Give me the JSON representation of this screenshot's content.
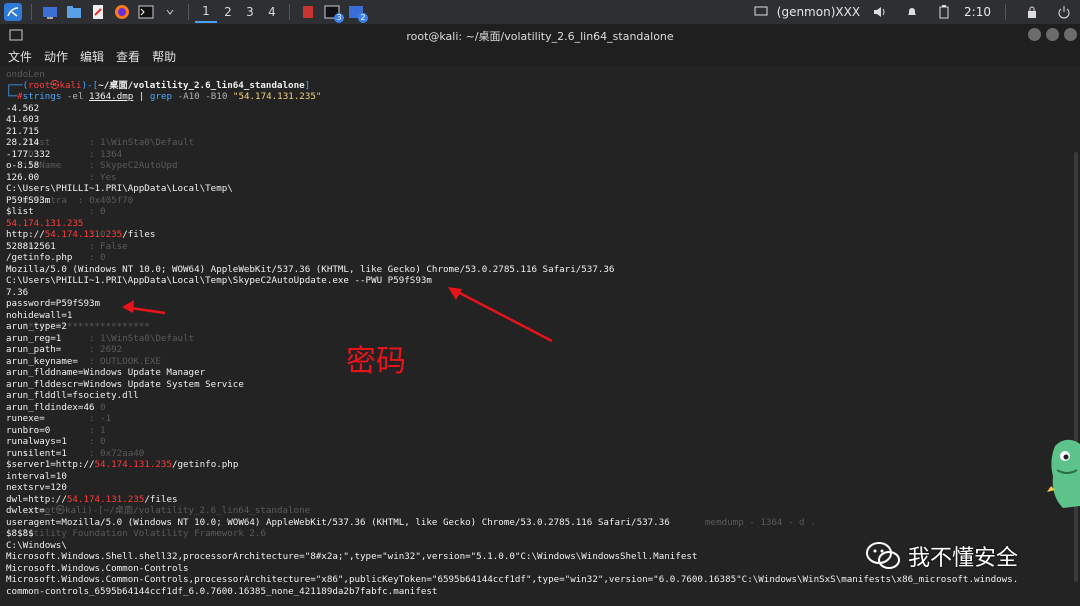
{
  "taskbar": {
    "workspaces": [
      "1",
      "2",
      "3",
      "4"
    ],
    "badges": [
      "3",
      "2"
    ],
    "genmon": "(genmon)XXX",
    "clock": "2:10"
  },
  "window": {
    "title": "root@kali: ~/桌面/volatility_2.6_lin64_standalone"
  },
  "menu": [
    "文件",
    "动作",
    "编辑",
    "查看",
    "帮助"
  ],
  "prompt": {
    "line1_prefix": "┌──(",
    "user": "root㉿kali",
    "line1_mid": ")-[",
    "path": "~/桌面/volatility_2.6_lin64_standalone",
    "line1_suffix": "]",
    "line2_prefix": "└─",
    "hash": "#",
    "cmd": "strings",
    "arg1": " -el ",
    "file": "1364.dmp",
    "pipe": " | ",
    "grep": "grep",
    "args": " -A10 -B10 ",
    "pattern": "\"54.174.131.235\""
  },
  "output": {
    "l1": "-4.562",
    "l2": "41.603",
    "l3": "21.715",
    "l4": "28.214",
    "l5": "-177.332",
    "l6": "o-8.58",
    "l7": "126.00",
    "l8": "C:\\Users\\PHILLI~1.PRI\\AppData\\Local\\Temp\\",
    "l9": "P59fS93m",
    "l10": "$list",
    "ip": "54.174.131.235",
    "http_prefix": "http://",
    "files": "/files",
    "l13": "528812561",
    "l14": "/getinfo.php",
    "l15": "Mozilla/5.0 (Windows NT 10.0; WOW64) AppleWebKit/537.36 (KHTML, like Gecko) Chrome/53.0.2785.116 Safari/537.36",
    "l16": "C:\\Users\\PHILLI~1.PRI\\AppData\\Local\\Temp\\SkypeC2AutoUpdate.exe --PWU P59fS93m",
    "l17": "7.36",
    "l18": "password=P59fS93m",
    "l19": "nohidewall=1",
    "l20": "arun_type=2",
    "l21": "arun_reg=1",
    "l22": "arun_path=",
    "l23": "arun_keyname=",
    "l24": "arun_flddname=Windows Update Manager",
    "l25": "arun_flddescr=Windows Update System Service",
    "l26": "arun_flddll=fsociety.dll",
    "l27": "arun_fldindex=46",
    "l28": "runexe=",
    "l29": "runbro=0",
    "l30": "runalways=1",
    "l31": "runsilent=1",
    "server1_prefix": "$server1=http://",
    "getinfo": "/getinfo.php",
    "l33": "interval=10",
    "l34": "nextsrv=120",
    "dwl_prefix": "dwl=http://",
    "l36": "dwlext=_",
    "l37": "useragent=Mozilla/5.0 (Windows NT 10.0; WOW64) AppleWebKit/537.36 (KHTML, like Gecko) Chrome/53.0.2785.116 Safari/537.36",
    "l38": "$8$8$",
    "l39": "C:\\Windows\\",
    "l40": "Microsoft.Windows.Shell.shell32,processorArchitecture=\"8#x2a;\",type=\"win32\",version=\"5.1.0.0\"C:\\Windows\\WindowsShell.Manifest",
    "l41": "Microsoft.Windows.Common-Controls",
    "l42": "Microsoft.Windows.Common-Controls,processorArchitecture=\"x86\",publicKeyToken=\"6595b64144ccf1df\",type=\"win32\",version=\"6.0.7600.16385\"C:\\Windows\\WinSxS\\manifests\\x86_microsoft.windows.",
    "l43": "common-controls_6595b64144ccf1df_6.0.7600.16385_none_421189da2b7fabfc.manifest"
  },
  "ghost": {
    "g0": "ondoLen",
    "g4": "   itest       : 1\\WinSta0\\Default",
    "g5": "   ID          : 1364",
    "g6": "   ileName     : SkypeC2AutoUpd",
    "g7": "               : Yes",
    "g9": "   WndExtra  : 0x405f70",
    "g10": "               : 0",
    "g12": "               : 0",
    "g13": "   rol         : False",
    "g14": "               : 0",
    "g20": "   ***********************",
    "g21": "               : 1\\WinSta0\\Default",
    "g22": "               : 2692",
    "g23": "               : OUTLOOK.EXE",
    "g27": "               : 0",
    "g28": "               : -1",
    "g29": "   ble         : 1",
    "g30": "               : 0",
    "g31": "   it          : 0x72aa40",
    "g36": "   _(root㉿kali)-[~/桌面/volatility_2.6_lin64_standalone",
    "g40": "   latility Foundation Volatility Framework 2.6",
    "right37": "memdump - 1364 - d ."
  },
  "annotation": {
    "label": "密码"
  },
  "watermark": {
    "text": "我不懂安全"
  },
  "colors": {
    "ip": "#ff3b3b",
    "prompt": "#4aa6ff",
    "annotation": "#e8131b"
  }
}
